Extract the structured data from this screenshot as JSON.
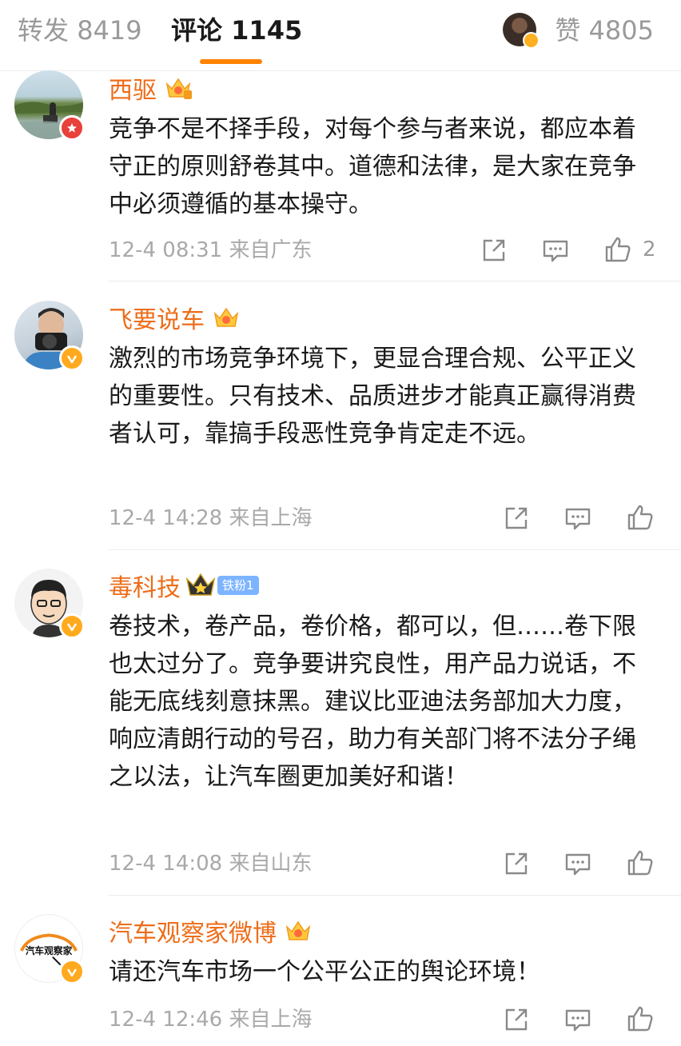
{
  "tabs": {
    "repost_label": "转发",
    "repost_count": "8419",
    "comments_label": "评论",
    "comments_count": "1145",
    "likes_label": "赞",
    "likes_count": "4805"
  },
  "colors": {
    "accent": "#ff8200",
    "username": "#ed6d19",
    "verified": "#ffaa1e",
    "meta": "#a9a9a9"
  },
  "comments": [
    {
      "username": "西驱",
      "text": "竞争不是不择手段，对每个参与者来说，都应本着守正的原则舒卷其中。道德和法律，是大家在竞争中必须遵循的基本操守。",
      "time": "12-4 08:31",
      "location": "来自广东",
      "like_count": "2"
    },
    {
      "username": "飞要说车",
      "text": "激烈的市场竞争环境下，更显合理合规、公平正义的重要性。只有技术、品质进步才能真正赢得消费者认可，靠搞手段恶性竞争肯定走不远。",
      "time": "12-4 14:28",
      "location": "来自上海",
      "like_count": ""
    },
    {
      "username": "毒科技",
      "fan_badge": "铁粉1",
      "text": "卷技术，卷产品，卷价格，都可以，但……卷下限也太过分了。竞争要讲究良性，用产品力说话，不能无底线刻意抹黑。建议比亚迪法务部加大力度，响应清朗行动的号召，助力有关部门将不法分子绳之以法，让汽车圈更加美好和谐！",
      "time": "12-4 14:08",
      "location": "来自山东",
      "like_count": ""
    },
    {
      "username": "汽车观察家微博",
      "avatar_text": "汽车观察家",
      "text": "请还汽车市场一个公平公正的舆论环境！",
      "time": "12-4 12:46",
      "location": "来自上海",
      "like_count": ""
    }
  ]
}
